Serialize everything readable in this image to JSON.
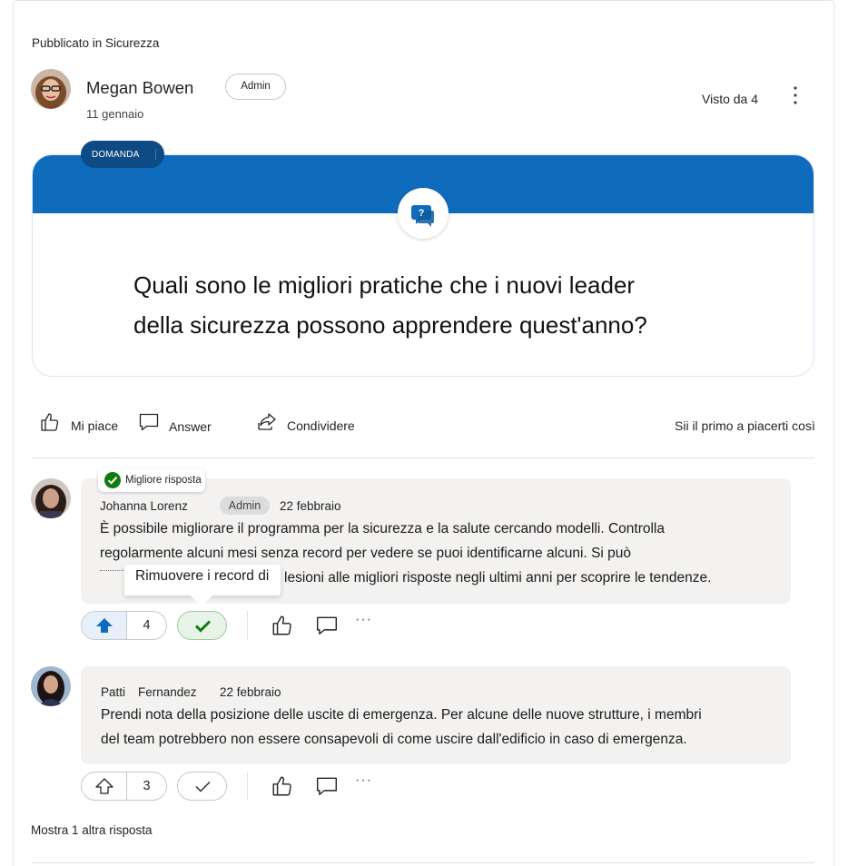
{
  "post": {
    "posted_in": "Pubblicato in Sicurezza",
    "author": "Megan Bowen",
    "author_role": "Admin",
    "date": "11 gennaio",
    "seen_by": "Visto da 4",
    "question_tag": "DOMANDA",
    "question_line1": "Quali sono le migliori pratiche che i nuovi leader",
    "question_line2": "della sicurezza possono apprendere quest'anno?"
  },
  "actions": {
    "like_label": "Mi piace",
    "answer_label": "Answer",
    "share_label": "Condividere",
    "like_first": "Sii il primo a piacerti così"
  },
  "replies": [
    {
      "best_badge": "Migliore risposta",
      "author": "Johanna Lorenz",
      "role": "Admin",
      "date": "22 febbraio",
      "line1": "È possibile migliorare il programma per la sicurezza e la salute cercando modelli. Controlla",
      "line2": "regolarmente alcuni mesi senza record per vedere se puoi identificarne alcuni. Si può",
      "line3_tail": "lesioni alle migliori risposte negli ultimi anni per scoprire le tendenze.",
      "tooltip": "Rimuovere i record di",
      "votes": "4",
      "upvoted": true,
      "accepted": true
    },
    {
      "author_first": "Patti",
      "author_last": "Fernandez",
      "date": "22 febbraio",
      "line1": "Prendi nota della posizione delle uscite di emergenza. Per alcune delle nuove strutture, i membri",
      "line2": "del team potrebbero non essere consapevoli di come uscire dall'edificio in caso di emergenza.",
      "votes": "3",
      "upvoted": false,
      "accepted": false
    }
  ],
  "show_more": "Mostra 1 altra risposta",
  "colors": {
    "brand_blue": "#0f6cbd",
    "tag_navy": "#0e4a84",
    "success_green": "#107c10",
    "bubble_gray": "#f3f2f1"
  },
  "icons": [
    "more-vertical-icon",
    "question-bubble-icon",
    "thumbs-up-icon",
    "comment-icon",
    "share-icon",
    "arrow-up-icon",
    "checkmark-icon",
    "ellipsis-icon"
  ]
}
